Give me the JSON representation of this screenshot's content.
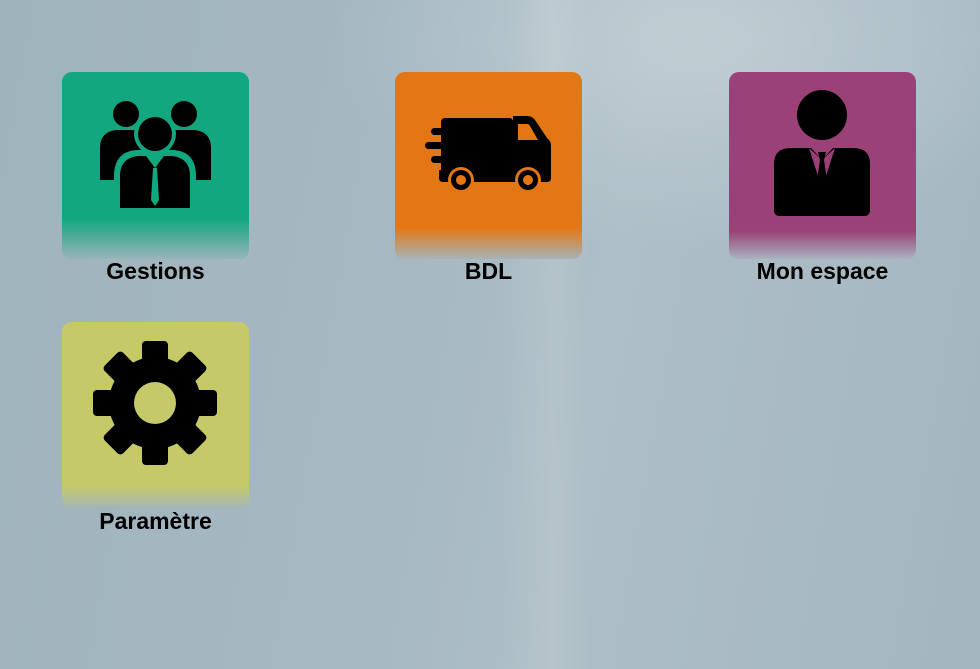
{
  "tiles": [
    {
      "label": "Gestions",
      "icon": "group-people-icon",
      "color": "#13a77f"
    },
    {
      "label": "BDL",
      "icon": "delivery-truck-icon",
      "color": "#e47613"
    },
    {
      "label": "Mon espace",
      "icon": "businessman-icon",
      "color": "#9a4277"
    },
    {
      "label": "Paramètre",
      "icon": "gear-icon",
      "color": "#c6c968"
    }
  ]
}
